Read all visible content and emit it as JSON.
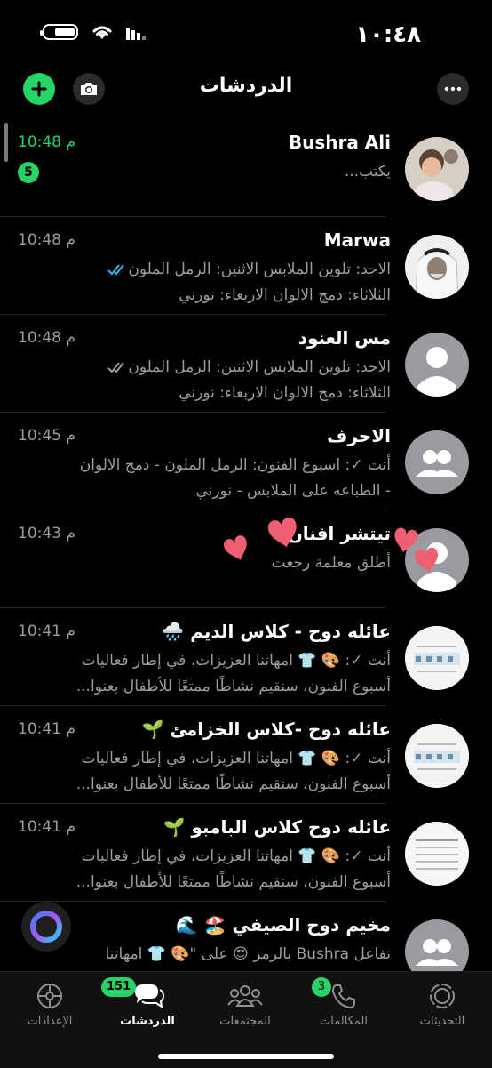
{
  "status_bar": {
    "time": "١٠:٤٨",
    "battery_level": 0.7
  },
  "header": {
    "title": "الدردشات"
  },
  "chats": [
    {
      "name": "Bushra Ali",
      "time": "10:48 م",
      "time_highlight": true,
      "line1": "يكتب...",
      "line2": "",
      "unread": "5",
      "ticks": ""
    },
    {
      "name": "Marwa",
      "time": "10:48 م",
      "line1": "الاحد: تلوين الملابس  الاثنين: الرمل الملون",
      "line2": "الثلاثاء: دمج الالوان الاربعاء: نورني",
      "ticks": "read"
    },
    {
      "name": "مس العنود",
      "time": "10:48 م",
      "line1": "الاحد: تلوين الملابس  الاثنين: الرمل الملون",
      "line2": "الثلاثاء: دمج الالوان الاربعاء: نورني",
      "ticks": "delivered"
    },
    {
      "name": "الاحرف",
      "time": "10:45 م",
      "line1": "أنت ✓: اسبوع الفنون: الرمل الملون - دمج الالوان",
      "line2": "- الطباعه على الملابس - نورني",
      "ticks": ""
    },
    {
      "name": "تيتشر افنان",
      "time": "10:43 م",
      "line1": "أطلق معلمة رجعت",
      "line2": "",
      "ticks": ""
    },
    {
      "name": "عائله دوح - كلاس الديم 🌧️",
      "time": "10:41 م",
      "line1": "أنت ✓: 🎨 👕 امهاتنا العزيزات، في إطار فعاليات",
      "line2": "أسبوع الفنون، سنقيم نشاطًا ممتعًا للأطفال بعنوا...",
      "ticks": ""
    },
    {
      "name": "عائله دوح -كلاس الخزامئ 🌱",
      "time": "10:41 م",
      "line1": "أنت ✓: 🎨 👕 امهاتنا العزيزات، في إطار فعاليات",
      "line2": "أسبوع الفنون، سنقيم نشاطًا ممتعًا للأطفال بعنوا...",
      "ticks": ""
    },
    {
      "name": "عائله دوح كلاس البامبو 🌱",
      "time": "10:41 م",
      "line1": "أنت ✓: 🎨 👕 امهاتنا العزيزات، في إطار فعاليات",
      "line2": "أسبوع الفنون، سنقيم نشاطًا ممتعًا للأطفال بعنوا...",
      "ticks": ""
    },
    {
      "name": "مخيم دوح الصيفي 🏖️ 🌊",
      "time": "",
      "line1": "تفاعل Bushra بالرمز 😍 على \"🎨 👕 امهاتنا",
      "line2": "",
      "ticks": ""
    }
  ],
  "tabs": [
    {
      "label": "التحديثات",
      "icon": "updates-icon"
    },
    {
      "label": "المكالمات",
      "icon": "calls-icon",
      "badge": "3"
    },
    {
      "label": "المجتمعات",
      "icon": "communities-icon"
    },
    {
      "label": "الدردشات",
      "icon": "chats-icon",
      "badge": "151",
      "active": true
    },
    {
      "label": "الإعدادات",
      "icon": "settings-icon"
    }
  ],
  "colors": {
    "accent": "#25d366",
    "read_tick": "#34b7f1",
    "muted_text": "#9c9ca1",
    "background": "#000000"
  }
}
